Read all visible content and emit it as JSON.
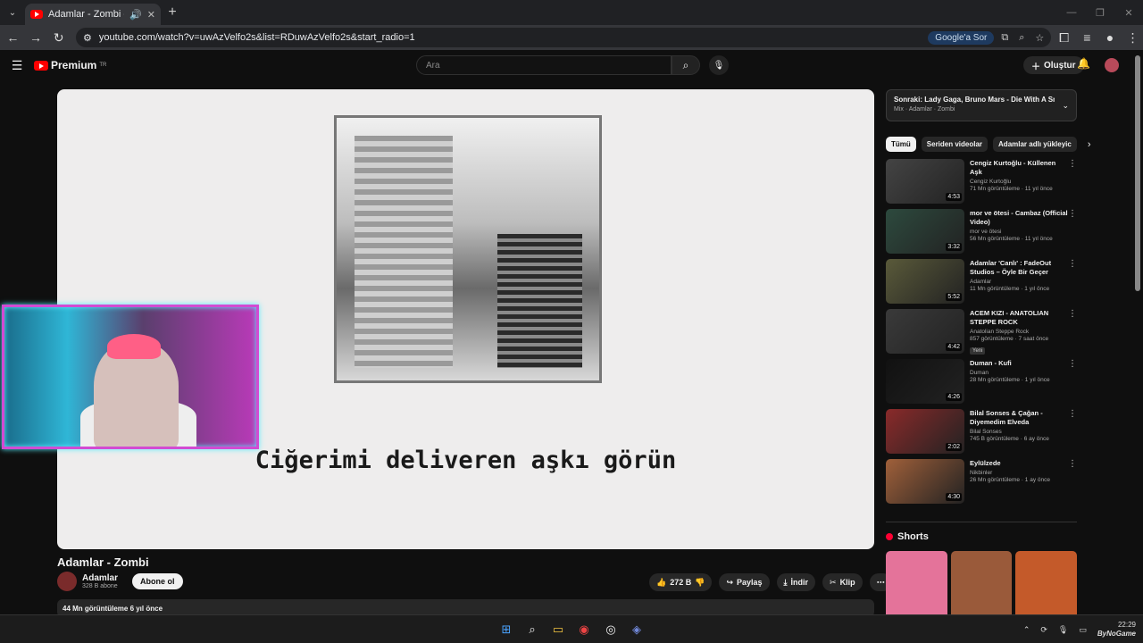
{
  "browser": {
    "tab_title": "Adamlar - Zombi - YouTube",
    "url": "youtube.com/watch?v=uwAzVelfo2s&list=RDuwAzVelfo2s&start_radio=1",
    "google_sor": "Google'a Sor"
  },
  "yt": {
    "logo": "Premium",
    "logo_sup": "TR",
    "search_placeholder": "Ara",
    "create": "Oluştur"
  },
  "video": {
    "lyric": "Ciğerimi deliveren aşkı görün",
    "title": "Adamlar - Zombi",
    "channel": "Adamlar",
    "subs": "328 B abone",
    "subscribe": "Abone ol",
    "likes": "272 B",
    "share": "Paylaş",
    "download": "İndir",
    "clip": "Klip",
    "views_line": "44 Mn görüntüleme  6 yıl önce"
  },
  "upnext": {
    "title": "Sonraki: Lady Gaga, Bruno Mars - Die With A Smile ...",
    "sub": "Mix · Adamlar · Zombi"
  },
  "chips": [
    "Tümü",
    "Seriden videolar",
    "Adamlar adlı yükleyic"
  ],
  "recs": [
    {
      "title": "Cengiz Kurtoğlu  - Küllenen Aşk",
      "channel": "Cengiz Kurtoğlu",
      "views": "71 Mn görüntüleme · 11 yıl önce",
      "dur": "4:53",
      "color": "#444"
    },
    {
      "title": "mor ve ötesi - Cambaz (Official Video)",
      "channel": "mor ve ötesi",
      "views": "56 Mn görüntüleme · 11 yıl önce",
      "dur": "3:32",
      "color": "#2d4a3e"
    },
    {
      "title": "Adamlar 'Canlı' : FadeOut Studios – Öyle Bir Geçer",
      "channel": "Adamlar",
      "views": "11 Mn görüntüleme · 1 yıl önce",
      "dur": "5:52",
      "color": "#5a5a3a"
    },
    {
      "title": "ACEM KIZI  - ANATOLIAN STEPPE ROCK",
      "channel": "Anatolian Steppe Rock",
      "views": "857 görüntüleme · 7 saat önce",
      "dur": "4:42",
      "color": "#3a3a3a",
      "new": "Yeni"
    },
    {
      "title": "Duman - Kufi",
      "channel": "Duman",
      "views": "28 Mn görüntüleme · 1 yıl önce",
      "dur": "4:26",
      "color": "#111"
    },
    {
      "title": "Bilal Sonses & Çağan - Diyemedim Elveda",
      "channel": "Bilal Sonses",
      "views": "745 B görüntüleme · 6 ay önce",
      "dur": "2:02",
      "color": "#8a2a2a"
    },
    {
      "title": "Eylülzede",
      "channel": "Nikbinler",
      "views": "26 Mn görüntüleme · 1 ay önce",
      "dur": "4:30",
      "color": "#a0603a"
    }
  ],
  "shorts_label": "Shorts",
  "clock": {
    "time": "22:29",
    "brand": "ByNoGame"
  },
  "colors": {
    "accent": "#ff0000",
    "cam_border": "#d24bd2"
  }
}
